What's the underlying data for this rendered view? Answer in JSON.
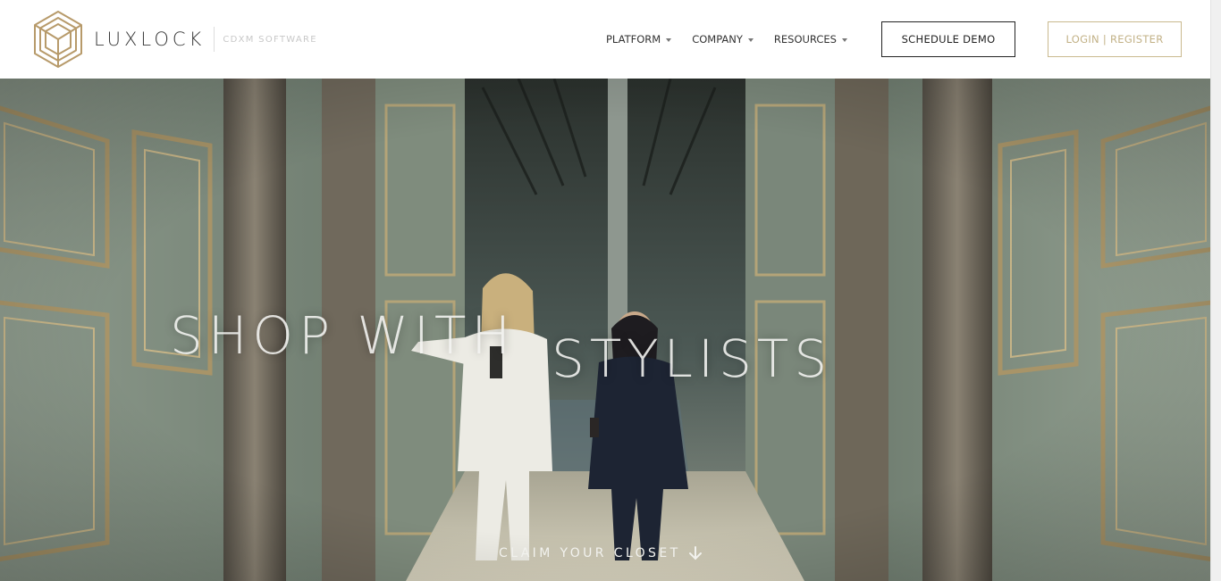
{
  "header": {
    "logo": {
      "wordmark": "LUXLOCK",
      "tagline": "CDXM SOFTWARE",
      "icon": "cube-logo-icon",
      "color": "#b79a6a"
    },
    "nav": [
      {
        "label": "PLATFORM",
        "icon": "caret-down-icon"
      },
      {
        "label": "COMPANY",
        "icon": "caret-down-icon"
      },
      {
        "label": "RESOURCES",
        "icon": "caret-down-icon"
      }
    ],
    "schedule_demo_label": "SCHEDULE DEMO",
    "login_label": "LOGIN | REGISTER",
    "accent_color": "#c2b186"
  },
  "hero": {
    "headline_part1": "SHOP WITH",
    "headline_part2": "STYLISTS",
    "cta_label": "CLAIM YOUR CLOSET",
    "cta_icon": "arrow-down-icon"
  }
}
